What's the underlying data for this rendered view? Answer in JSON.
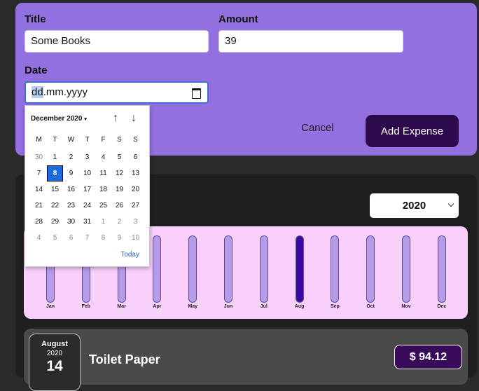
{
  "form": {
    "title_label": "Title",
    "title_value": "Some Books",
    "amount_label": "Amount",
    "amount_value": "39",
    "date_label": "Date",
    "date_placeholder_highlight": "dd",
    "date_placeholder_rest": ".mm.yyyy",
    "cancel_label": "Cancel",
    "add_label": "Add Expense",
    "calendar_icon": "calendar-icon"
  },
  "datepicker": {
    "month_label": "December 2020",
    "caret": "▾",
    "prev_arrow": "↑",
    "next_arrow": "↓",
    "weekdays": [
      "M",
      "T",
      "W",
      "T",
      "F",
      "S",
      "S"
    ],
    "weeks": [
      [
        "30",
        "1",
        "2",
        "3",
        "4",
        "5",
        "6"
      ],
      [
        "7",
        "8",
        "9",
        "10",
        "11",
        "12",
        "13"
      ],
      [
        "14",
        "15",
        "16",
        "17",
        "18",
        "19",
        "20"
      ],
      [
        "21",
        "22",
        "23",
        "24",
        "25",
        "26",
        "27"
      ],
      [
        "28",
        "29",
        "30",
        "31",
        "1",
        "2",
        "3"
      ],
      [
        "4",
        "5",
        "6",
        "7",
        "8",
        "9",
        "10"
      ]
    ],
    "selected_day": "8",
    "today_label": "Today"
  },
  "filter": {
    "year": "2020"
  },
  "chart_data": {
    "type": "bar",
    "categories": [
      "Jan",
      "Feb",
      "Mar",
      "Apr",
      "May",
      "Jun",
      "Jul",
      "Aug",
      "Sep",
      "Oct",
      "Nov",
      "Dec"
    ],
    "values": [
      0,
      0,
      0,
      0,
      0,
      0,
      0,
      1,
      0,
      0,
      0,
      0
    ],
    "title": "",
    "xlabel": "",
    "ylabel": "",
    "ylim": [
      0,
      1
    ]
  },
  "expense": {
    "month": "August",
    "year": "2020",
    "day": "14",
    "title": "Toilet Paper",
    "price": "$ 94.12"
  },
  "colors": {
    "form_bg": "#9370e0",
    "add_button": "#2d0a4b",
    "chart_bg": "#f8d0fb",
    "bar_fill": "#3a0aa0",
    "bar_empty": "#b79bea"
  }
}
